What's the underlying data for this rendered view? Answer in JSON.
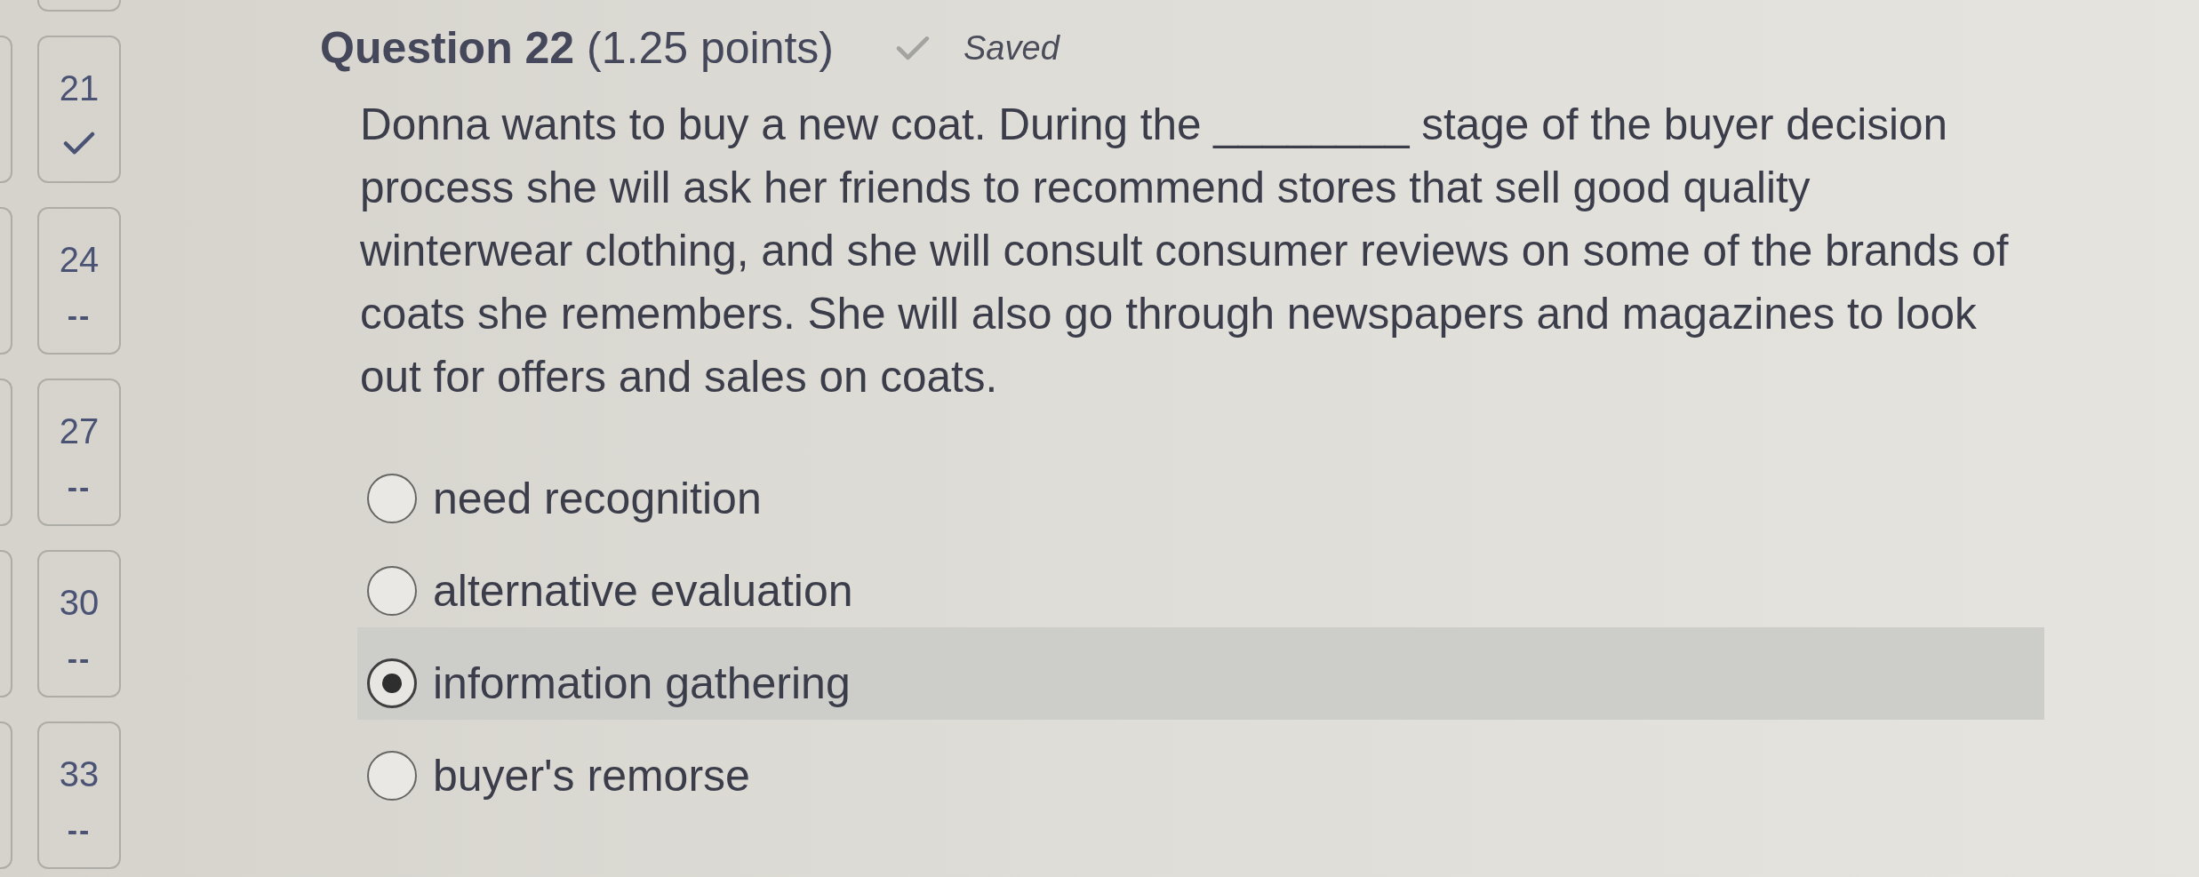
{
  "question_nav": [
    {
      "number": "21",
      "answered": true
    },
    {
      "number": "24",
      "answered": false,
      "status": "--"
    },
    {
      "number": "27",
      "answered": false,
      "status": "--"
    },
    {
      "number": "30",
      "answered": false,
      "status": "--"
    },
    {
      "number": "33",
      "answered": false,
      "status": "--"
    }
  ],
  "question": {
    "title": "**Question 22** (1.25 points)",
    "save_status": {
      "saved": true,
      "label": "Saved"
    },
    "prompt": "Donna wants to buy a new coat. During the ________ stage of the buyer decision process she will ask her friends to recommend stores that sell good quality winterwear clothing, and she will consult consumer reviews on some of the brands of coats she remembers. She will also go through newspapers and magazines to look out for offers and sales on coats.",
    "options": [
      {
        "label": "need recognition",
        "selected": false
      },
      {
        "label": "alternative evaluation",
        "selected": false
      },
      {
        "label": "information gathering",
        "selected": true
      },
      {
        "label": "buyer's remorse",
        "selected": false
      }
    ]
  }
}
